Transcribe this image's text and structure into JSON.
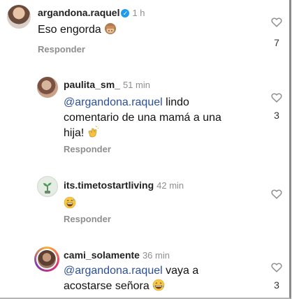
{
  "comments": [
    {
      "username": "argandona.raquel",
      "verified": true,
      "time": "1 h",
      "text": "Eso engorda",
      "emoji": "see-no-evil-monkey",
      "reply_label": "Responder",
      "likes": "7"
    },
    {
      "username": "paulita_sm_",
      "time": "51 min",
      "mention": "@argandona.raquel",
      "text_a": "lindo",
      "text_b": "comentario de una mamá a una",
      "text_c": "hija!",
      "emoji": "clapping-hands",
      "reply_label": "Responder",
      "likes": "3"
    },
    {
      "username": "its.timetostartliving",
      "time": "42 min",
      "emoji": "grinning-sweat-face",
      "reply_label": "Responder"
    },
    {
      "username": "cami_solamente",
      "time": "36 min",
      "mention": "@argandona.raquel",
      "text_a": "vaya a",
      "text_b": "acostarse señora",
      "emoji": "laughing-tears-face",
      "likes": "3"
    }
  ]
}
